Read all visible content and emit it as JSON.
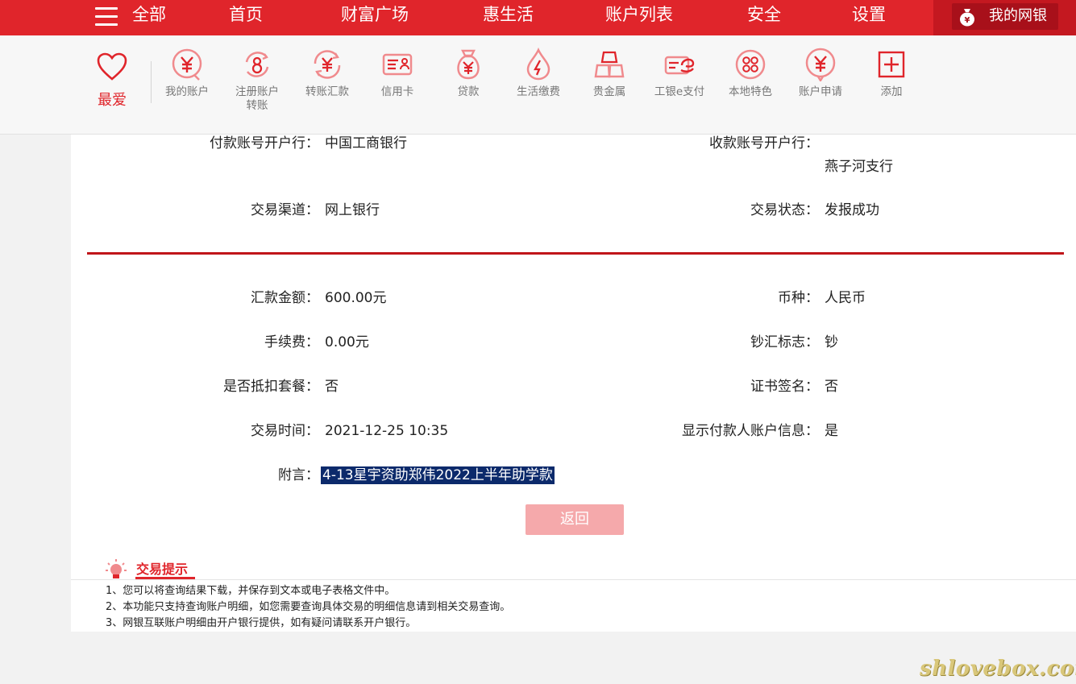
{
  "nav": {
    "all": "全部",
    "items": [
      "首页",
      "财富广场",
      "惠生活",
      "账户列表",
      "安全",
      "设置"
    ],
    "my_bank": "我的网银"
  },
  "toolbar": {
    "favorite": "最爱",
    "items": [
      {
        "label": "我的账户",
        "icon": "yuan-circle-icon"
      },
      {
        "label": "注册账户转账",
        "icon": "transfer-register-icon"
      },
      {
        "label": "转账汇款",
        "icon": "transfer-icon"
      },
      {
        "label": "信用卡",
        "icon": "credit-card-icon"
      },
      {
        "label": "贷款",
        "icon": "money-bag-icon"
      },
      {
        "label": "生活缴费",
        "icon": "utility-drop-icon"
      },
      {
        "label": "贵金属",
        "icon": "gold-bars-icon"
      },
      {
        "label": "工银e支付",
        "icon": "epay-icon"
      },
      {
        "label": "本地特色",
        "icon": "local-dots-icon"
      },
      {
        "label": "账户申请",
        "icon": "account-apply-icon"
      },
      {
        "label": "添加",
        "icon": "add-icon"
      }
    ]
  },
  "detail": {
    "payer_bank_label": "付款账号开户行：",
    "payer_bank": "中国工商银行",
    "payee_bank_label": "收款账号开户行：",
    "payee_bank": "燕子河支行",
    "channel_label": "交易渠道：",
    "channel": "网上银行",
    "status_label": "交易状态：",
    "status": "发报成功",
    "amount_label": "汇款金额：",
    "amount": "600.00元",
    "currency_label": "币种：",
    "currency": "人民币",
    "fee_label": "手续费：",
    "fee": "0.00元",
    "cash_flag_label": "钞汇标志：",
    "cash_flag": "钞",
    "package_label": "是否抵扣套餐：",
    "package": "否",
    "cert_label": "证书签名：",
    "cert": "否",
    "time_label": "交易时间：",
    "time": "2021-12-25 10:35",
    "show_payer_label": "显示付款人账户信息：",
    "show_payer": "是",
    "memo_label": "附言：",
    "memo": "4-13星宇资助郑伟2022上半年助学款",
    "return_button": "返回"
  },
  "tips": {
    "title": "交易提示",
    "lines": [
      "1、您可以将查询结果下载，并保存到文本或电子表格文件中。",
      "2、本功能只支持查询账户明细，如您需要查询具体交易的明细信息请到相关交易查询。",
      "3、网银互联账户明细由开户银行提供，如有疑问请联系开户银行。"
    ]
  },
  "watermark": "shlovebox.com",
  "colors": {
    "brand_red": "#e0252b",
    "dark_red": "#c0151a",
    "memo_highlight": "#0c2a6b"
  }
}
